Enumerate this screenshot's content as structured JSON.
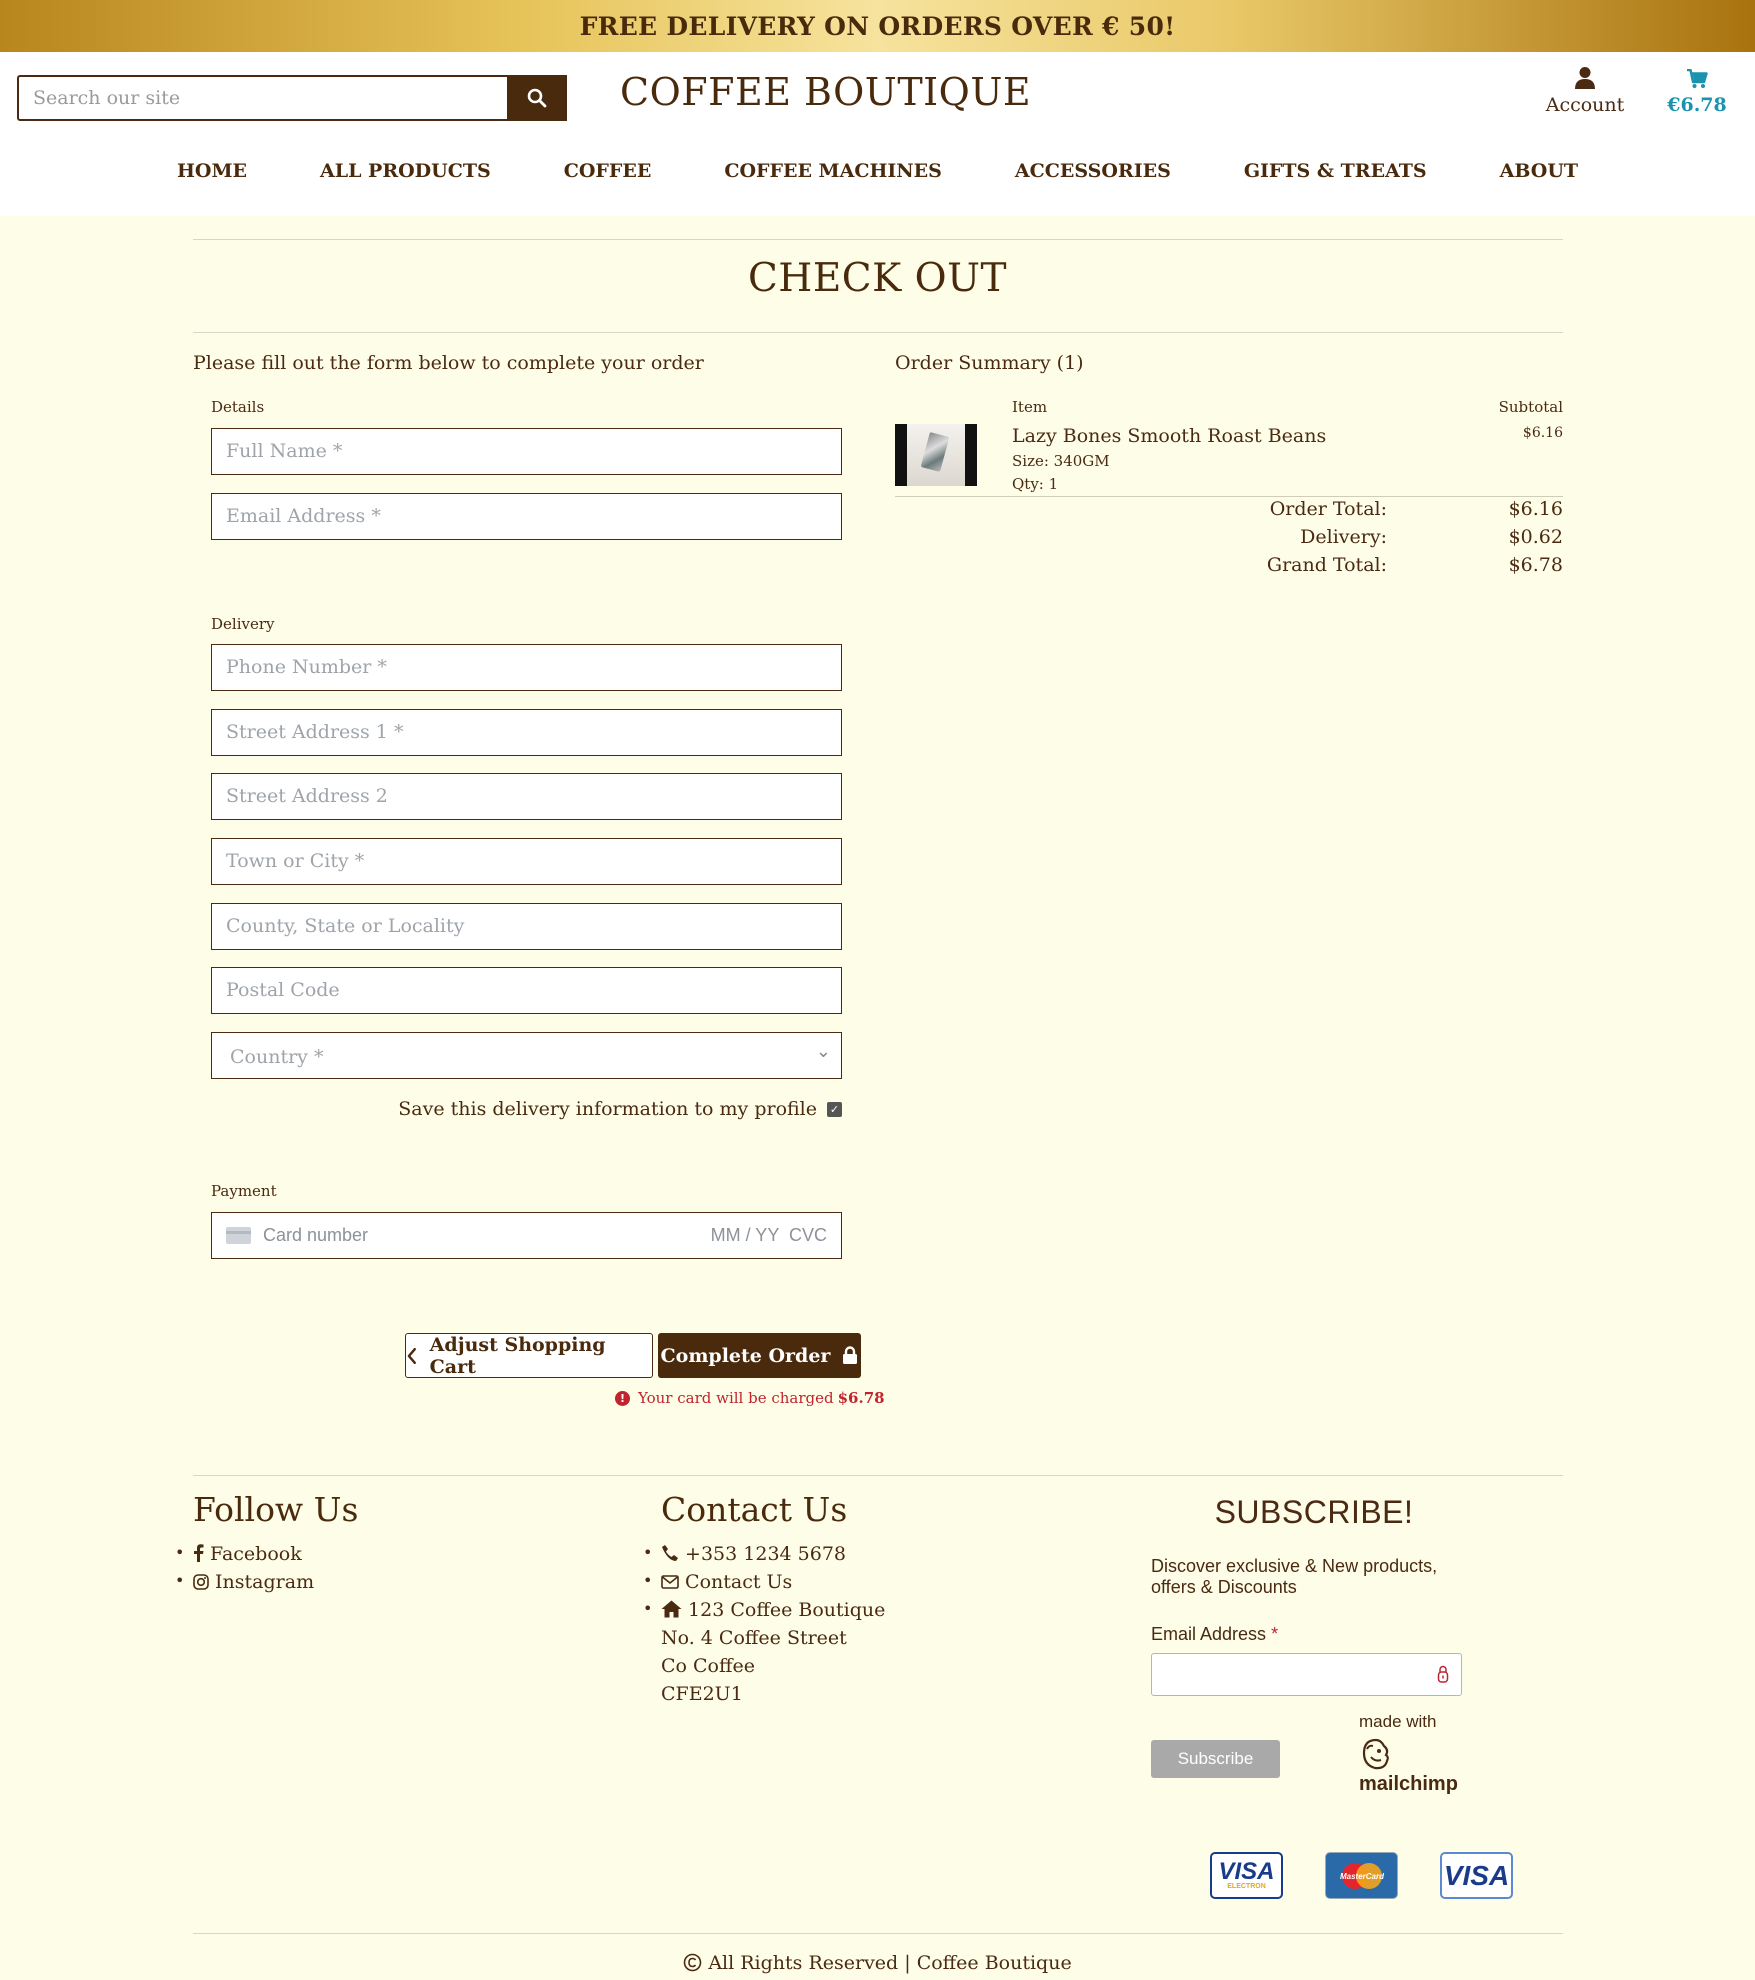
{
  "banner": {
    "text": "FREE DELIVERY ON ORDERS OVER € 50!"
  },
  "header": {
    "search_placeholder": "Search our site",
    "logo": "COFFEE BOUTIQUE",
    "account_label": "Account",
    "cart_total": "€6.78"
  },
  "nav": [
    "HOME",
    "ALL PRODUCTS",
    "COFFEE",
    "COFFEE MACHINES",
    "ACCESSORIES",
    "GIFTS & TREATS",
    "ABOUT"
  ],
  "page": {
    "title": "CHECK OUT",
    "intro": "Please fill out the form below to complete your order"
  },
  "form": {
    "details_label": "Details",
    "full_name_ph": "Full Name *",
    "email_ph": "Email Address *",
    "delivery_label": "Delivery",
    "phone_ph": "Phone Number *",
    "street1_ph": "Street Address 1 *",
    "street2_ph": "Street Address 2",
    "town_ph": "Town or City *",
    "county_ph": "County, State or Locality",
    "postal_ph": "Postal Code",
    "country_ph": "Country *",
    "save_label": "Save this delivery information to my profile",
    "save_checked": true,
    "payment_label": "Payment",
    "card_ph": "Card number",
    "card_exp_cvc": "MM / YY  CVC",
    "adjust_label": "Adjust Shopping Cart",
    "complete_label": "Complete Order",
    "charge_text": "Your card will be charged",
    "charge_amount": "$6.78"
  },
  "summary": {
    "title": "Order Summary (1)",
    "col_item": "Item",
    "col_subtotal": "Subtotal",
    "item_name": "Lazy Bones Smooth Roast Beans",
    "item_size": "Size: 340GM",
    "item_qty": "Qty: 1",
    "item_subtotal": "$6.16",
    "order_total_label": "Order Total:",
    "order_total": "$6.16",
    "delivery_label": "Delivery:",
    "delivery": "$0.62",
    "grand_total_label": "Grand Total:",
    "grand_total": "$6.78"
  },
  "footer": {
    "follow_title": "Follow Us",
    "facebook": "Facebook",
    "instagram": "Instagram",
    "contact_title": "Contact Us",
    "phone": "+353 1234 5678",
    "contact_link": "Contact Us",
    "addr1": "123 Coffee Boutique",
    "addr2": "No. 4 Coffee Street",
    "addr3": "Co Coffee",
    "addr4": "CFE2U1",
    "subscribe_title": "SUBSCRIBE!",
    "subscribe_text": "Discover exclusive & New products, offers & Discounts",
    "email_label": "Email Address",
    "subscribe_btn": "Subscribe",
    "made_with": "made with",
    "mailchimp": "mailchimp",
    "copyright": "All Rights Reserved | Coffee Boutique",
    "payment_icons": [
      "visa-electron",
      "mastercard",
      "visa"
    ]
  },
  "colors": {
    "brand": "#4a2a0c",
    "accent": "#1c93ae",
    "background": "#fefde8",
    "error": "#c0242f"
  }
}
